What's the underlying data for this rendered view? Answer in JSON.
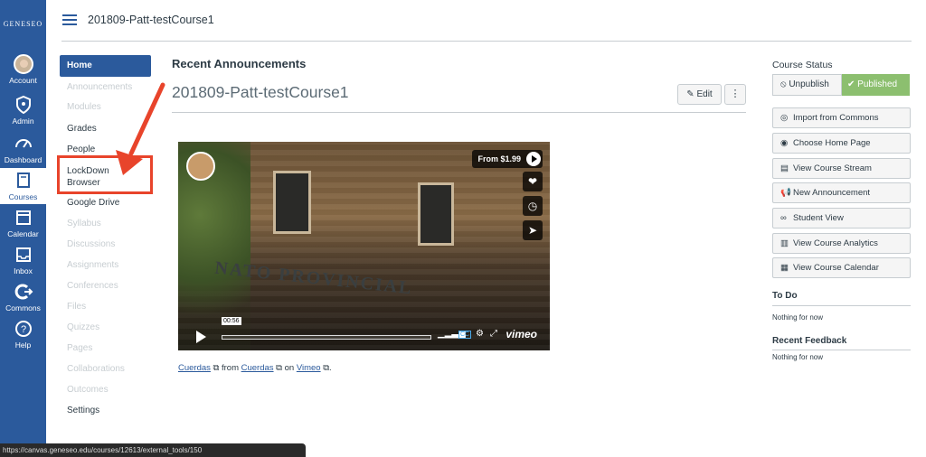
{
  "global_nav": {
    "logo": "GENESEO",
    "items": [
      {
        "label": "Account"
      },
      {
        "label": "Admin"
      },
      {
        "label": "Dashboard"
      },
      {
        "label": "Courses"
      },
      {
        "label": "Calendar"
      },
      {
        "label": "Inbox"
      },
      {
        "label": "Commons"
      },
      {
        "label": "Help"
      }
    ]
  },
  "header": {
    "breadcrumb": "201809-Patt-testCourse1"
  },
  "course_nav": [
    "Home",
    "Announcements",
    "Modules",
    "Grades",
    "People",
    "LockDown Browser",
    "Google Drive",
    "Syllabus",
    "Discussions",
    "Assignments",
    "Conferences",
    "Files",
    "Quizzes",
    "Pages",
    "Collaborations",
    "Outcomes",
    "Settings"
  ],
  "main": {
    "section_heading": "Recent Announcements",
    "course_title": "201809-Patt-testCourse1",
    "edit_label": "Edit",
    "more_label": "⋮"
  },
  "video": {
    "price_label": "From $1.99",
    "sign_text": "NATO PROVINCIAL",
    "timestamp": "00:56",
    "brand": "vimeo"
  },
  "credits": {
    "title_link": "Cuerdas",
    "from_text": "from",
    "author_link": "Cuerdas",
    "on_text": "on",
    "site_link": "Vimeo",
    "end": "."
  },
  "sidebar": {
    "course_status_label": "Course Status",
    "unpublish_label": "Unpublish",
    "published_label": "Published",
    "buttons": [
      {
        "label": "Import from Commons",
        "icon": "import-icon"
      },
      {
        "label": "Choose Home Page",
        "icon": "home-page-icon"
      },
      {
        "label": "View Course Stream",
        "icon": "stream-icon"
      },
      {
        "label": "New Announcement",
        "icon": "announcement-icon"
      },
      {
        "label": "Student View",
        "icon": "glasses-icon"
      },
      {
        "label": "View Course Analytics",
        "icon": "analytics-icon"
      },
      {
        "label": "View Course Calendar",
        "icon": "calendar-icon"
      }
    ],
    "todo_heading": "To Do",
    "todo_note": "Nothing for now",
    "feedback_heading": "Recent Feedback",
    "feedback_note": "Nothing for now"
  },
  "status_bar": {
    "url": "https://canvas.geneseo.edu/courses/12613/external_tools/150"
  },
  "colors": {
    "nav_blue": "#2b5a9c",
    "highlight_red": "#e8442b",
    "published_green": "#8cbf6f"
  }
}
